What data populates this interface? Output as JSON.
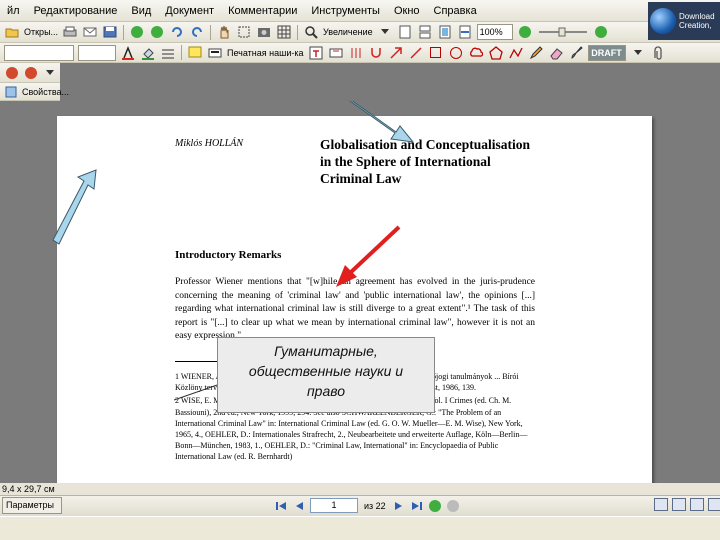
{
  "menu": [
    "йл",
    "Редактирование",
    "Вид",
    "Документ",
    "Комментарии",
    "Инструменты",
    "Окно",
    "Справка"
  ],
  "toolbar1": {
    "open_label": "Откры...",
    "zoom_label": "Увеличение",
    "zoom_value": "100%"
  },
  "toolbar2": {
    "print_label": "Печатная наши-ка",
    "stamp_label": "DRAFT"
  },
  "toolbar4_label": "Свойства...",
  "side_panel_label": "ltext[1]",
  "download_badge": {
    "line1": "Download",
    "line2": "Creation,"
  },
  "document": {
    "author": "Miklós HOLLÁN",
    "title_lines": [
      "Globalisation and Conceptualisation",
      "in the Sphere of International",
      "Criminal Law"
    ],
    "heading": "Introductory Remarks",
    "paragraph": "Professor Wiener mentions that \"[w]hile an agreement has evolved in the juris-prudence concerning the meaning of 'criminal law' and 'public international law', the opinions [...] regarding what international criminal law is still diverge to a great extent\".¹ The task of this report is \"[...] to clear up what we mean by international criminal law\", however it is not an easy expression.\"",
    "footnotes": [
      "1   WIENER, A.: \"... alkalmazása és ...\" ... (International Criminal Law ...) Büntetőjogi tanulmányok ... Bírói Közlöny tervezete (ed.: Szilk ...) ... Közlöny Közlöny ... aki Főszemlély, Budapest, 1986, 139.",
      "2   WISE, E. M.: \"Perspectives and Approaches\" in: International Criminal Law. Vol. I Crimes (ed. Ch. M. Bassiouni), 2nd ed., New York, 1999, 294. See also SCHWARZENBERGER, G.: \"The Problem of an International Criminal Law\" in: International Criminal Law (ed. G. O. W. Mueller—E. M. Wise), New York, 1965, 4., OEHLER, D.: Internationales Strafrecht, 2., Neubearbeitete und erweiterte Auflage, Köln—Berlin—Bonn—München, 1983, 1., OEHLER, D.: \"Criminal Law, International\" in: Encyclopaedia of Public International Law (ed. R. Bernhardt)"
    ]
  },
  "callout": {
    "lines": [
      "Гуманитарные,",
      "общественные науки и",
      "право"
    ]
  },
  "status": {
    "zoom_text": "9,4 x 29,7 см",
    "params_label": "Параметры",
    "current_page": "1",
    "page_of": "из 22"
  },
  "colors": {
    "red_arrow": "#e0201e",
    "blue_arrow": "#a9d6ea"
  }
}
